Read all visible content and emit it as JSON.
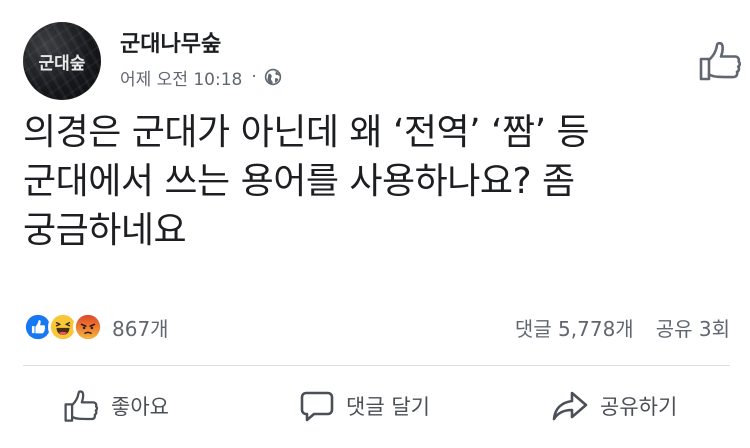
{
  "post": {
    "author": {
      "name": "군대나무숲",
      "avatar_text": "군대숲"
    },
    "meta": {
      "time": "어제 오전 10:18",
      "separator": "·",
      "privacy_icon": "globe-icon"
    },
    "text_lines": [
      "의경은 군대가 아닌데 왜 ‘전역’ ‘짬’ 등",
      "군대에서 쓰는 용어를 사용하나요? 좀",
      "궁금하네요"
    ],
    "reactions": {
      "icons": [
        "like-reaction-icon",
        "haha-reaction-icon",
        "angry-reaction-icon"
      ],
      "count": "867개"
    },
    "comments": "댓글 5,778개",
    "shares": "공유 3회",
    "actions": {
      "like": "좋아요",
      "comment": "댓글 달기",
      "share": "공유하기"
    }
  },
  "colors": {
    "text": "#1c1e21",
    "secondary": "#616770",
    "action": "#4b4f56",
    "like_blue": "#1877f2",
    "haha_yellow": "#f7c739",
    "angry_orange": "#e9710f",
    "divider": "#dadde1"
  }
}
